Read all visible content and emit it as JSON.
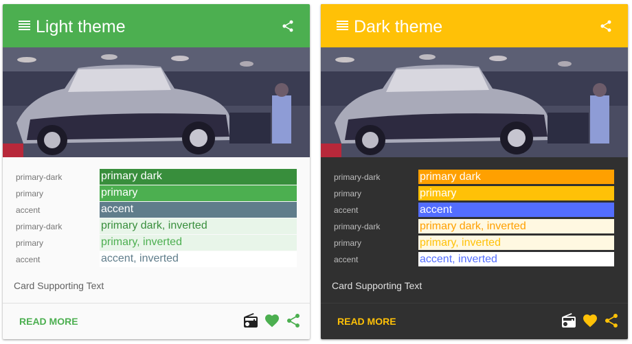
{
  "cards": [
    {
      "id": "light",
      "title": "Light theme",
      "read_more": "READ MORE",
      "supporting_text": "Card Supporting Text",
      "colors": {
        "header": "#4caf50",
        "accent_text": "#4caf50",
        "card_bg": "#fafafa"
      },
      "swatches": [
        {
          "label": "primary-dark",
          "text": "primary dark",
          "bg": "#388e3c",
          "fg": "#ffffff",
          "border": "none"
        },
        {
          "label": "primary",
          "text": "primary",
          "bg": "#4caf50",
          "fg": "#ffffff",
          "border": "none"
        },
        {
          "label": "accent",
          "text": "accent",
          "bg": "#607d8b",
          "fg": "#ffffff",
          "border": "none"
        },
        {
          "label": "primary-dark",
          "text": "primary dark, inverted",
          "bg": "#e8f5e9",
          "fg": "#388e3c",
          "border": "none"
        },
        {
          "label": "primary",
          "text": "primary, inverted",
          "bg": "#e8f5e9",
          "fg": "#4caf50",
          "border": "none"
        },
        {
          "label": "accent",
          "text": "accent, inverted",
          "bg": "#ffffff",
          "fg": "#607d8b",
          "border": "none"
        }
      ],
      "icons": [
        "radio-icon",
        "heart-icon",
        "share-icon"
      ],
      "icon_colors": [
        "#212121",
        "#4caf50",
        "#4caf50"
      ]
    },
    {
      "id": "dark",
      "title": "Dark theme",
      "read_more": "READ MORE",
      "supporting_text": "Card Supporting Text",
      "colors": {
        "header": "#ffc107",
        "accent_text": "#ffc107",
        "card_bg": "#303030"
      },
      "swatches": [
        {
          "label": "primary-dark",
          "text": "primary dark",
          "bg": "#ffa000",
          "fg": "#ffffff",
          "border": "#303030"
        },
        {
          "label": "primary",
          "text": "primary",
          "bg": "#ffc107",
          "fg": "#ffffff",
          "border": "#303030"
        },
        {
          "label": "accent",
          "text": "accent",
          "bg": "#536dfe",
          "fg": "#ffffff",
          "border": "#303030"
        },
        {
          "label": "primary-dark",
          "text": "primary dark, inverted",
          "bg": "#fff8e1",
          "fg": "#ffa000",
          "border": "#303030"
        },
        {
          "label": "primary",
          "text": "primary, inverted",
          "bg": "#fff8e1",
          "fg": "#ffc107",
          "border": "#303030"
        },
        {
          "label": "accent",
          "text": "accent, inverted",
          "bg": "#ffffff",
          "fg": "#536dfe",
          "border": "#303030"
        }
      ],
      "icons": [
        "radio-icon",
        "heart-icon",
        "share-icon"
      ],
      "icon_colors": [
        "#ffffff",
        "#ffc107",
        "#ffc107"
      ]
    }
  ]
}
